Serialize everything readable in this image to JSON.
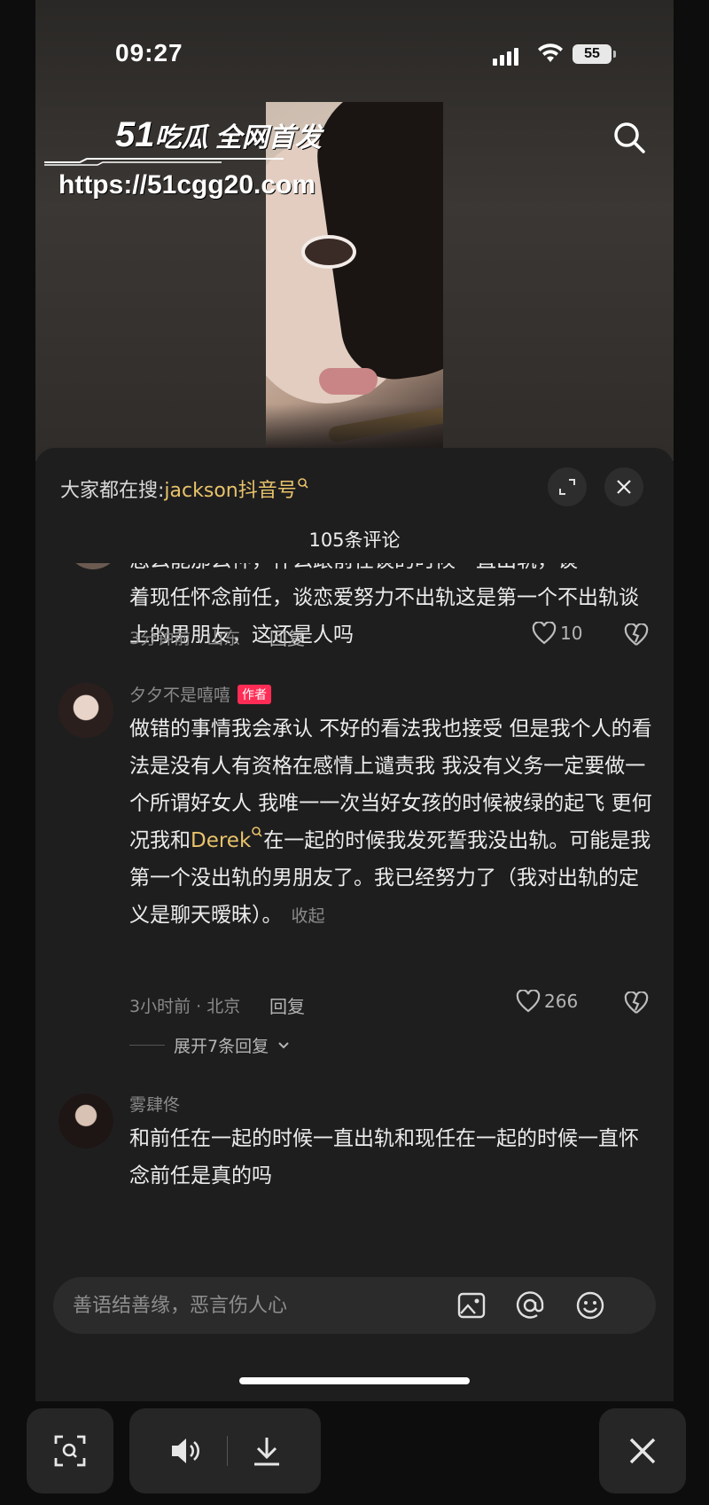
{
  "status": {
    "time": "09:27",
    "battery": "55"
  },
  "watermark": {
    "brand": "吃瓜 全网首发",
    "brand_num": "51",
    "url": "https://51cgg20.com"
  },
  "sheet": {
    "hot_prefix": "大家都在搜:",
    "hot_keyword": "jackson抖音号",
    "comment_count": "105条评论"
  },
  "comments": [
    {
      "text_clipped": "怎么能那么神，什么跟前任谈的时候一直出轨，谈",
      "text": "着现任怀念前任，谈恋爱努力不出轨这是第一个不出轨谈上的男朋友，这还是人吗",
      "meta": "3分钟前 · 山东",
      "reply": "回复",
      "likes": "10"
    },
    {
      "name": "夕夕不是嘻嘻",
      "tag": "作者",
      "text_a": "做错的事情我会承认 不好的看法我也接受 但是我个人的看法是没有人有资格在感情上谴责我 我没有义务一定要做一个所谓好女人 我唯一一次当好女孩的时候被绿的起飞 更何况我和",
      "mention": "Derek",
      "text_b": "在一起的时候我发死誓我没出轨。可能是我第一个没出轨的男朋友了。我已经努力了（我对出轨的定义是聊天暧昧）。",
      "collapse": "收起",
      "meta": "3小时前 · 北京",
      "reply": "回复",
      "likes": "266",
      "expand": "展开7条回复"
    },
    {
      "name": "雾肆佟",
      "text": "和前任在一起的时候一直出轨和现任在一起的时候一直怀念前任是真的吗"
    }
  ],
  "input": {
    "placeholder": "善语结善缘，恶言伤人心"
  },
  "icons": {
    "search": "search-icon",
    "expand": "expand-icon",
    "close": "close-icon",
    "heart": "heart-icon",
    "dislike": "broken-heart-icon",
    "image": "image-icon",
    "at": "at-icon",
    "emoji": "emoji-icon",
    "scan": "scan-icon",
    "volume": "volume-icon",
    "download": "download-icon"
  },
  "colors": {
    "accent": "#e8c36a",
    "author_tag": "#ff2c55",
    "sheet_bg": "#1f1e1f"
  }
}
